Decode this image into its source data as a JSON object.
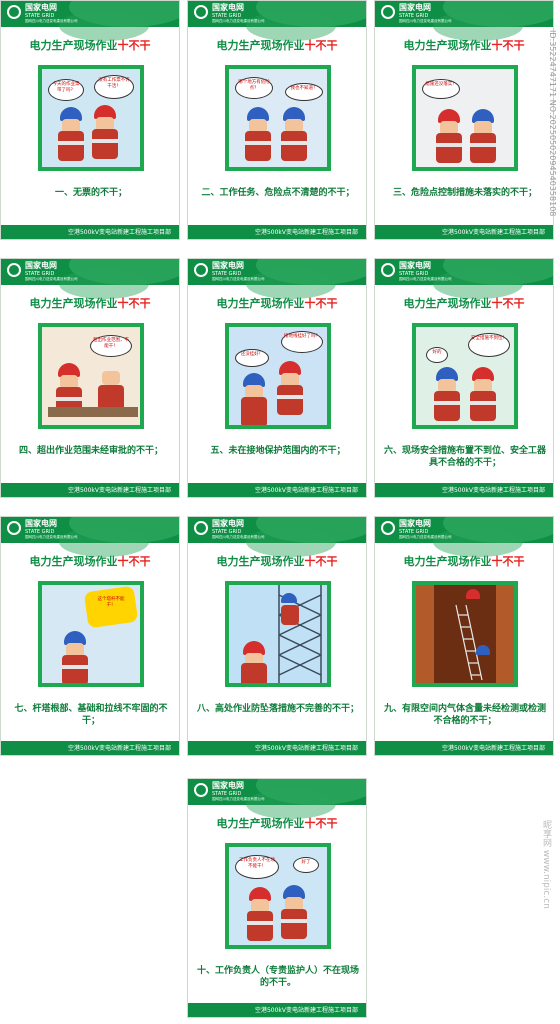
{
  "common": {
    "brand": "国家电网",
    "brand_en": "STATE GRID",
    "company": "国网四川电力送变电建设有限公司",
    "title_main": "电力生产现场作业",
    "title_emph": "十不干",
    "footer": "空港500kV变电站新建工程施工项目部"
  },
  "panels": [
    {
      "caption": "一、无票的不干；",
      "bubbles": [
        "今天的作业票带了吗？",
        "没有工作票不许干活！"
      ]
    },
    {
      "caption": "二、工作任务、危险点不清楚的不干；",
      "bubbles": [
        "哪个地方有危险点？",
        "我也不知道！"
      ]
    },
    {
      "caption": "三、危险点控制措施未落实的不干；",
      "bubbles": [
        "措施还没落实！"
      ]
    },
    {
      "caption": "四、超出作业范围未经审批的不干；",
      "bubbles": [
        "超出作业范围，不能干！"
      ]
    },
    {
      "caption": "五、未在接地保护范围内的不干；",
      "bubbles": [
        "接地线挂好了吗？",
        "还没挂好！"
      ]
    },
    {
      "caption": "六、现场安全措施布置不到位、安全工器具不合格的不干；",
      "bubbles": [
        "安全措施不到位！",
        "好的"
      ]
    },
    {
      "caption": "七、杆塔根部、基础和拉线不牢固的不干；",
      "bubbles": [
        "这个塔杆不能干！"
      ]
    },
    {
      "caption": "八、高处作业防坠落措施不完善的不干；",
      "bubbles": []
    },
    {
      "caption": "九、有限空间内气体含量未经检测或检测不合格的不干；",
      "bubbles": []
    },
    {
      "caption": "十、工作负责人（专责监护人）不在现场的不干。",
      "bubbles": [
        "工作负责人不在场不能干！",
        "好了"
      ]
    }
  ],
  "watermark": "ID:35224747171 NO:20250502094540358108",
  "site_mark": "昵享网 www.nipic.cn"
}
